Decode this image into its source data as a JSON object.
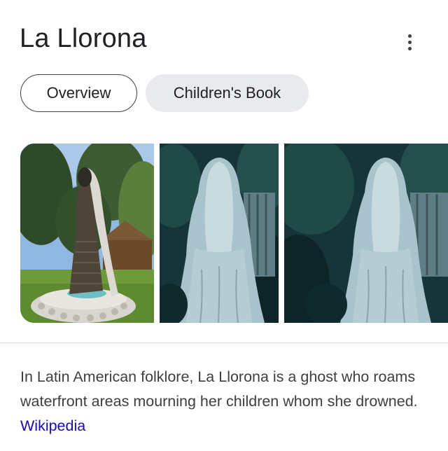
{
  "panel": {
    "title": "La Llorona",
    "more_icon": "more-vert-icon"
  },
  "tabs": [
    {
      "label": "Overview",
      "selected": true
    },
    {
      "label": "Children's Book",
      "selected": false
    }
  ],
  "images": [
    {
      "subject": "statue"
    },
    {
      "subject": "veiled-ghost-figure"
    },
    {
      "subject": "veiled-ghost-figure"
    }
  ],
  "description": {
    "text": "In Latin American folklore, La Llorona is a ghost who roams waterfront areas mourning her children whom she drowned.",
    "source_link": "Wikipedia"
  },
  "colors": {
    "link": "#1a0dab",
    "chip_inactive_bg": "#e8eaed",
    "text": "#202124"
  }
}
